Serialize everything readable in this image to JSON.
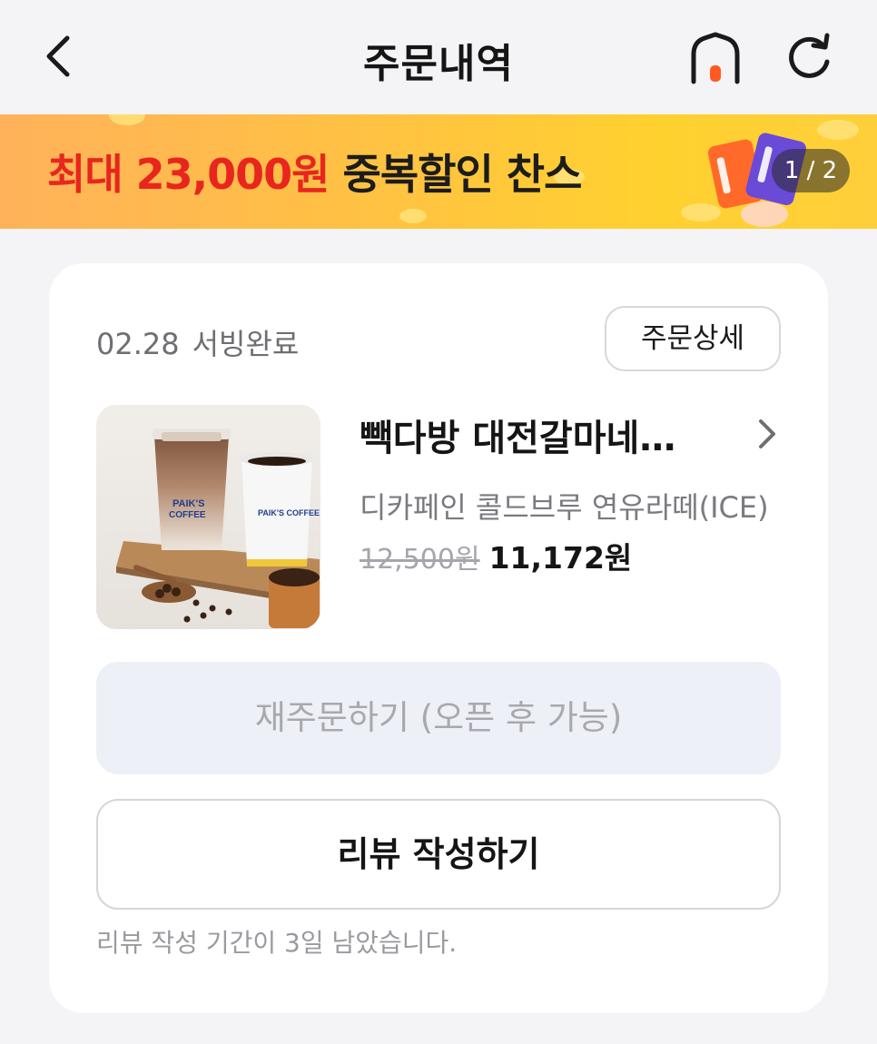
{
  "header": {
    "title": "주문내역",
    "back_icon": "chevron-left-icon",
    "home_icon": "home-icon",
    "refresh_icon": "refresh-icon",
    "home_accent_color": "#ff5a1f"
  },
  "banner": {
    "text_red": "최대 23,000원",
    "text_dark": "중복할인 찬스",
    "page_indicator": "1 / 2",
    "colors": {
      "red": "#e8261e",
      "background": "#ffc341"
    }
  },
  "order": {
    "date": "02.28",
    "status": "서빙완료",
    "detail_button": "주문상세",
    "store_name": "빽다방 대전갈마네거리점",
    "menu_name": "디카페인 콜드브루 연유라떼(ICE)",
    "price_original": "12,500원",
    "price_final": "11,172원",
    "reorder_button": "재주문하기 (오픈 후 가능)",
    "review_button": "리뷰 작성하기",
    "review_note": "리뷰 작성 기간이 3일 남았습니다."
  }
}
